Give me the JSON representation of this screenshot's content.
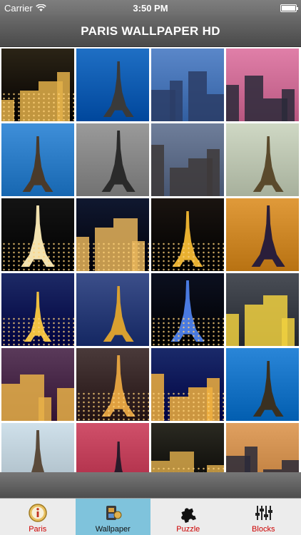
{
  "status_bar": {
    "carrier": "Carrier",
    "time": "3:50 PM",
    "battery_level": 1.0
  },
  "nav": {
    "title": "PARIS WALLPAPER HD"
  },
  "grid": {
    "tiles": [
      {
        "scene": "street-cafe-night",
        "sky": "#2b2416",
        "accent": "#e3b04a"
      },
      {
        "scene": "eiffel-blue-sky",
        "sky": "#1f6fc4",
        "accent": "#3a3a3a"
      },
      {
        "scene": "la-defense-towers",
        "sky": "#5a87c9",
        "accent": "#2c3d66"
      },
      {
        "scene": "louvre-pyramid-sunset",
        "sky": "#e07fa8",
        "accent": "#2a2a3a"
      },
      {
        "scene": "eiffel-blue-sky-tree",
        "sky": "#3f8fd9",
        "accent": "#4a3a2a"
      },
      {
        "scene": "eiffel-clouds-bw",
        "sky": "#9a9a9a",
        "accent": "#2a2a2a"
      },
      {
        "scene": "notre-dame-dusk",
        "sky": "#6f7e9a",
        "accent": "#3e3a3a"
      },
      {
        "scene": "eiffel-pale-sky",
        "sky": "#cfd8c4",
        "accent": "#5a4a2c"
      },
      {
        "scene": "eiffel-night-city",
        "sky": "#141414",
        "accent": "#f2e2b0"
      },
      {
        "scene": "paris-night-aerial",
        "sky": "#101830",
        "accent": "#e6b45a"
      },
      {
        "scene": "eiffel-fountains-night",
        "sky": "#1a1410",
        "accent": "#e8b030"
      },
      {
        "scene": "eiffel-sunset-orange",
        "sky": "#e09a3a",
        "accent": "#2a1e3a"
      },
      {
        "scene": "eiffel-moon-blue",
        "sky": "#1d2a66",
        "accent": "#f0c040"
      },
      {
        "scene": "eiffel-river-dusk",
        "sky": "#3c4f8a",
        "accent": "#d9a030"
      },
      {
        "scene": "eiffel-tricolor-lights",
        "sky": "#0c1020",
        "accent": "#4a7ae0"
      },
      {
        "scene": "trocadero-storm",
        "sky": "#4a4e56",
        "accent": "#f0d040"
      },
      {
        "scene": "paris-panorama-dusk",
        "sky": "#5a3a5a",
        "accent": "#e8b048"
      },
      {
        "scene": "eiffel-close-dusk",
        "sky": "#4a3a3a",
        "accent": "#e0a040"
      },
      {
        "scene": "obelisk-night",
        "sky": "#1a2a6a",
        "accent": "#f0b040"
      },
      {
        "scene": "eiffel-white-clouds",
        "sky": "#2a86d8",
        "accent": "#3a3020"
      },
      {
        "scene": "eiffel-autumn-leaves",
        "sky": "#cfe0ea",
        "accent": "#5a4a3a"
      },
      {
        "scene": "eiffel-pink-sky",
        "sky": "#d0506a",
        "accent": "#2a1a2a"
      },
      {
        "scene": "hotel-de-ville",
        "sky": "#2b2a22",
        "accent": "#d8a84a"
      },
      {
        "scene": "alexandre-bridge-sunset",
        "sky": "#e0a060",
        "accent": "#2a2a3a"
      }
    ]
  },
  "tabs": [
    {
      "label": "Paris",
      "icon": "info-icon",
      "active": false
    },
    {
      "label": "Wallpaper",
      "icon": "film-icon",
      "active": true
    },
    {
      "label": "Puzzle",
      "icon": "puzzle-icon",
      "active": false
    },
    {
      "label": "Blocks",
      "icon": "sliders-icon",
      "active": false
    }
  ]
}
